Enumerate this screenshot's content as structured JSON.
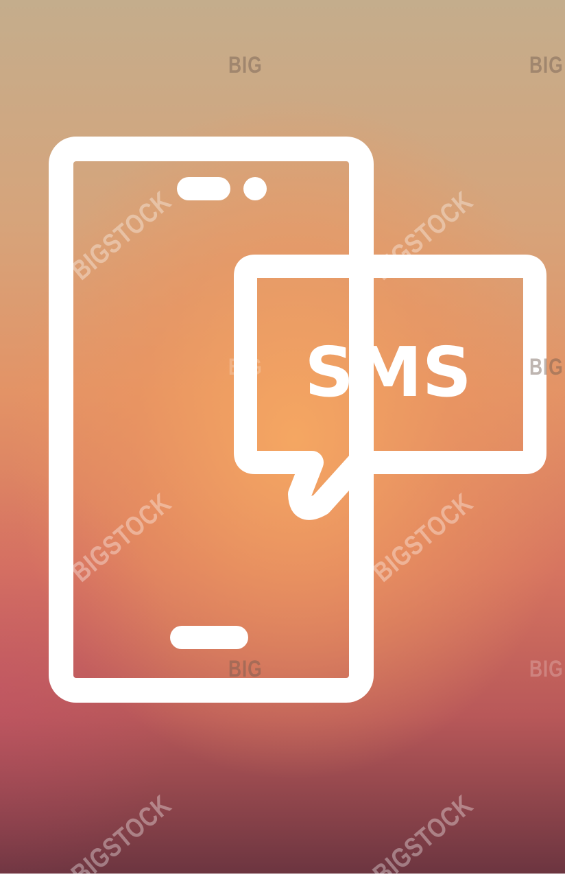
{
  "icon": {
    "name": "mobile-phone-sms-icon",
    "bubble_text": "SMS",
    "stroke_color": "#ffffff"
  },
  "background": {
    "top_color": "#c4ad8c",
    "center_color": "#f4a462",
    "bottom_color": "#6c3540"
  },
  "watermark": {
    "short": "BIG",
    "long": "BIGSTOCK"
  }
}
